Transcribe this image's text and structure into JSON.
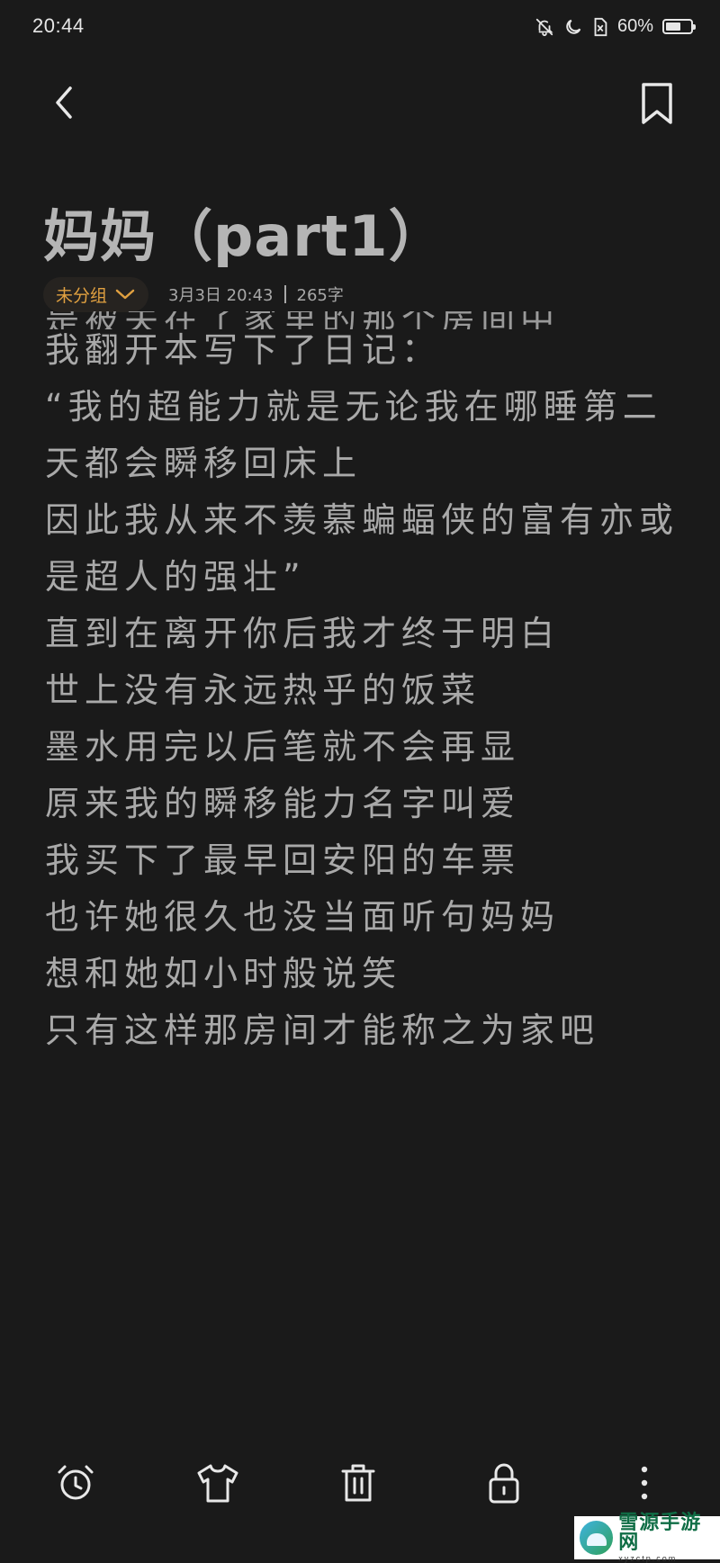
{
  "status_bar": {
    "time": "20:44",
    "battery_percent_label": "60%",
    "battery_level": 0.6,
    "icons": [
      "bell-off-icon",
      "moon-icon",
      "sim-off-icon",
      "battery-icon"
    ]
  },
  "nav": {
    "back_icon": "chevron-left-icon",
    "bookmark_icon": "bookmark-icon"
  },
  "note": {
    "title": "妈妈（part1）",
    "group_label": "未分组",
    "date": "3月3日 20:43",
    "word_count": "265字",
    "partial_line": "是被关在了家里的那个房间中",
    "lines": [
      "我翻开本写下了日记：",
      "“我的超能力就是无论我在哪睡第二",
      "天都会瞬移回床上",
      "因此我从来不羡慕蝙蝠侠的富有亦或",
      "是超人的强壮”",
      "直到在离开你后我才终于明白",
      "世上没有永远热乎的饭菜",
      "墨水用完以后笔就不会再显",
      "原来我的瞬移能力名字叫爱",
      "我买下了最早回安阳的车票",
      "也许她很久也没当面听句妈妈",
      "想和她如小时般说笑",
      "只有这样那房间才能称之为家吧"
    ]
  },
  "toolbar": {
    "items": [
      "alarm-clock-icon",
      "tshirt-icon",
      "trash-icon",
      "lock-icon",
      "more-vertical-icon"
    ]
  },
  "watermark": {
    "name": "雪源手游网",
    "url": "xyzctp.com"
  },
  "colors": {
    "background": "#1a1a1a",
    "accent": "#e0a040",
    "text": "#a9a9a9"
  }
}
